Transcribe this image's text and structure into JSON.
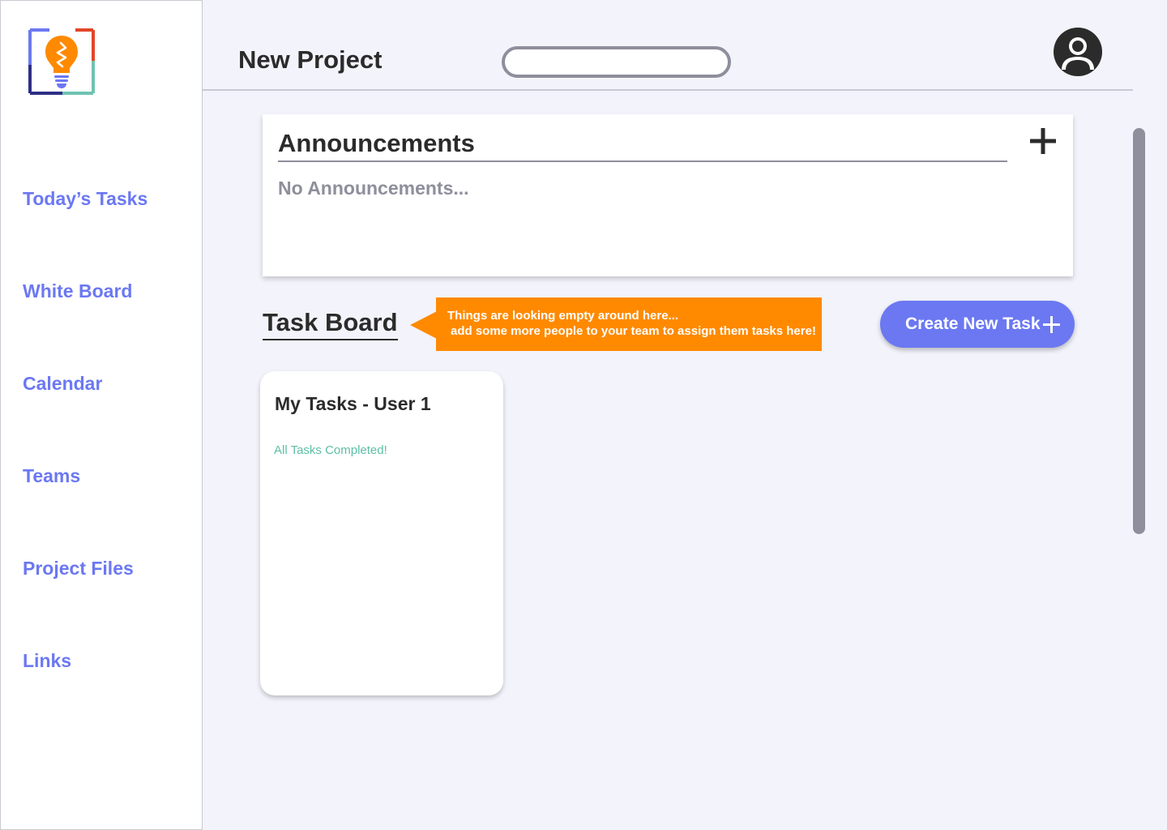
{
  "sidebar": {
    "items": [
      {
        "label": "Today’s Tasks"
      },
      {
        "label": "White Board"
      },
      {
        "label": "Calendar"
      },
      {
        "label": "Teams"
      },
      {
        "label": "Project Files"
      },
      {
        "label": "Links"
      }
    ]
  },
  "header": {
    "title": "New Project",
    "search_value": "",
    "avatar_icon": "user-avatar-icon"
  },
  "announcements": {
    "title": "Announcements",
    "empty_text": "No Announcements...",
    "add_icon": "plus-icon"
  },
  "task_board": {
    "title": "Task Board",
    "tooltip_line1": "Things are looking empty around here...",
    "tooltip_line2": "add some more people to your team to assign them tasks here!",
    "create_button_label": "Create New Task",
    "cards": [
      {
        "title": "My Tasks - User 1",
        "status": "All Tasks Completed!"
      }
    ]
  },
  "colors": {
    "accent": "#6B78F2",
    "tooltip": "#FF8A00",
    "success": "#5CBFA4",
    "muted": "#8E8E9C",
    "background": "#F3F3FB"
  }
}
